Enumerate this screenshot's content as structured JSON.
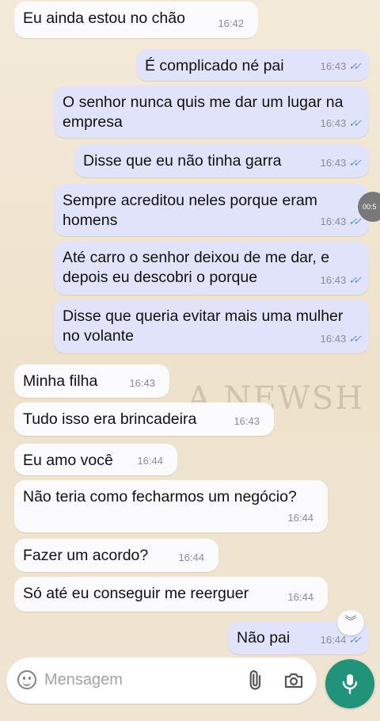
{
  "messages": [
    {
      "dir": "in",
      "text": "Eu ainda estou no chão",
      "time": "16:42",
      "read": false
    },
    {
      "dir": "out",
      "text": "É complicado né pai",
      "time": "16:43",
      "read": true
    },
    {
      "dir": "out",
      "text": "O senhor nunca quis me dar um lugar na empresa",
      "time": "16:43",
      "read": true
    },
    {
      "dir": "out",
      "text": "Disse que eu não tinha garra",
      "time": "16:43",
      "read": true
    },
    {
      "dir": "out",
      "text": "Sempre acreditou neles porque eram homens",
      "time": "16:43",
      "read": true
    },
    {
      "dir": "out",
      "text": "Até carro o senhor deixou de me dar, e depois eu descobri o porque",
      "time": "16:43",
      "read": true
    },
    {
      "dir": "out",
      "text": "Disse que queria evitar mais uma mulher no volante",
      "time": "16:43",
      "read": true
    },
    {
      "dir": "in",
      "text": "Minha filha",
      "time": "16:43",
      "read": false
    },
    {
      "dir": "in",
      "text": "Tudo isso era brincadeira",
      "time": "16:43",
      "read": false
    },
    {
      "dir": "in",
      "text": "Eu amo você",
      "time": "16:44",
      "read": false
    },
    {
      "dir": "in",
      "text": "Não teria como fecharmos um negócio?",
      "time": "16:44",
      "read": false
    },
    {
      "dir": "in",
      "text": "Fazer um acordo?",
      "time": "16:44",
      "read": false
    },
    {
      "dir": "in",
      "text": "Só até eu conseguir me reerguer",
      "time": "16:44",
      "read": false
    },
    {
      "dir": "out",
      "text": "Não pai",
      "time": "16:44",
      "read": true
    }
  ],
  "watermark": "A NEWSH",
  "timer_badge": "00:5",
  "composer": {
    "placeholder": "Mensagem"
  },
  "icons": {
    "emoji": "emoji-icon",
    "attach": "paperclip-icon",
    "camera": "camera-icon",
    "mic": "microphone-icon",
    "scroll": "chevron-double-down-icon",
    "read": "double-check-icon"
  },
  "colors": {
    "incoming": "#fbfbfd",
    "outgoing": "#e1e3fa",
    "accent": "#21937b",
    "ticks": "#4f8fe0"
  }
}
